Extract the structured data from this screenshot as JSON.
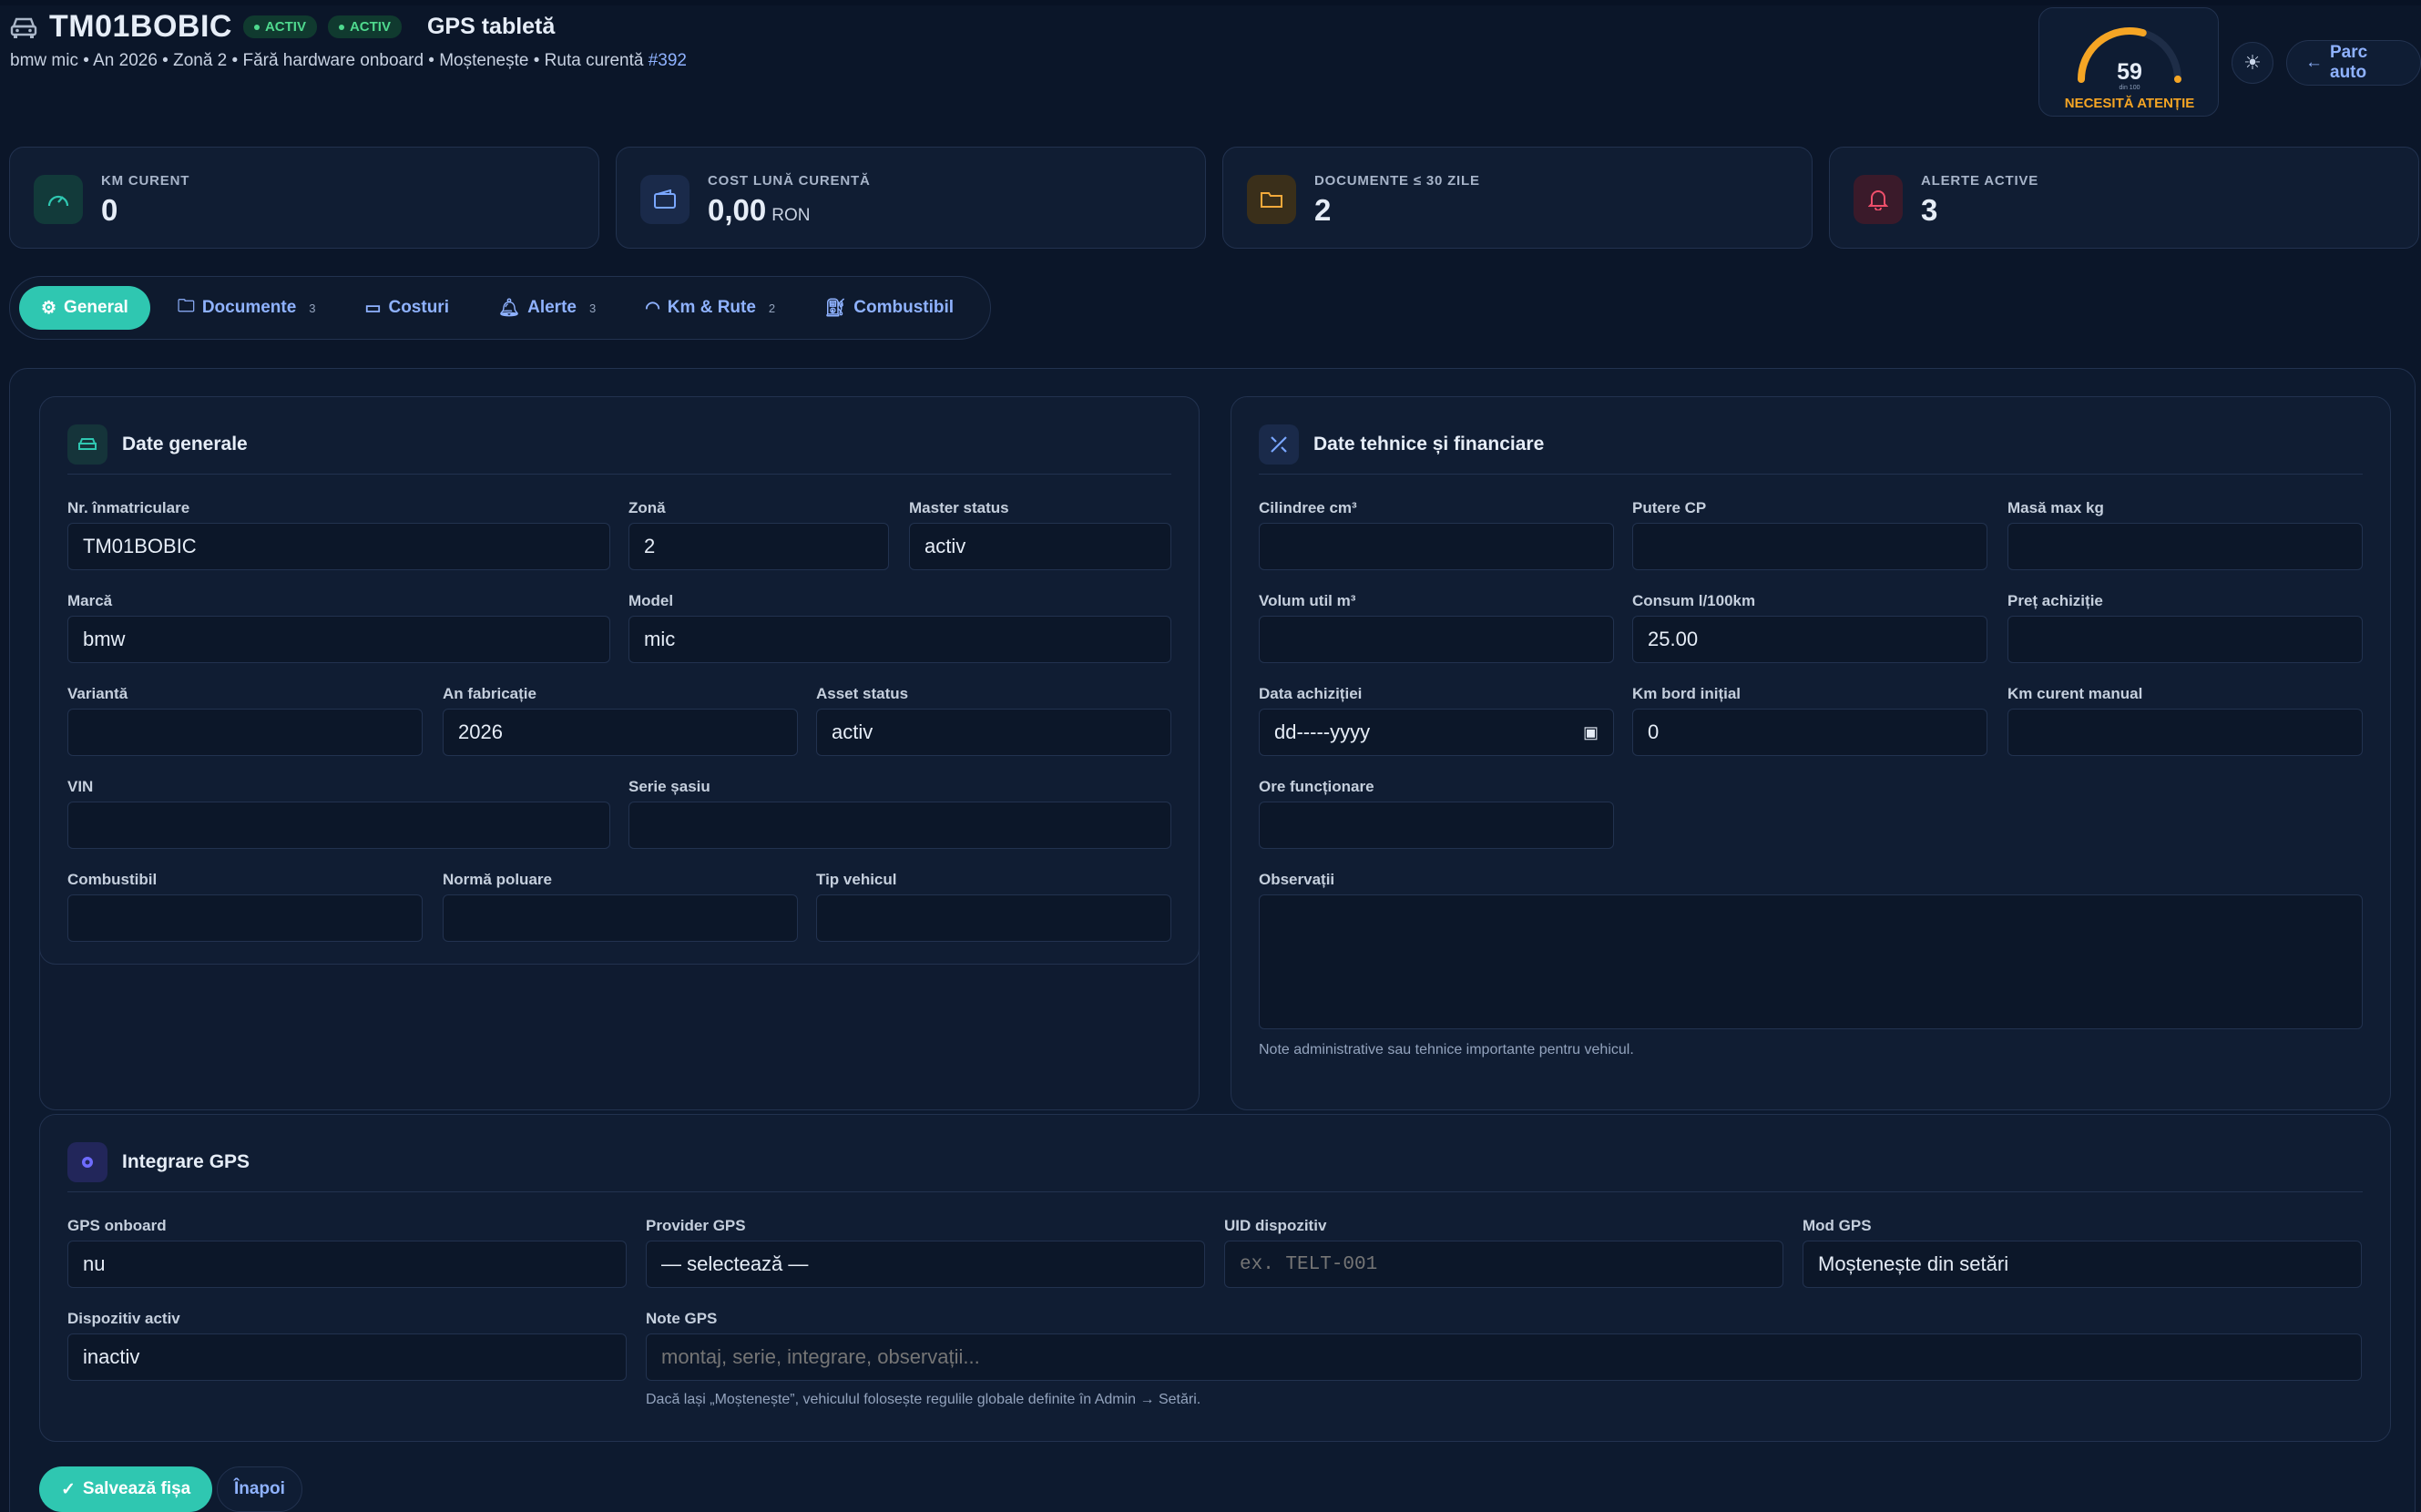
{
  "header": {
    "plate": "TM01BOBIC",
    "badges": [
      "ACTIV",
      "ACTIV"
    ],
    "gps_title": "GPS tabletă",
    "subtitle_text": "bmw mic • An 2026 • Zonă 2 • Fără hardware onboard • Moștenește • Ruta curentă ",
    "route_link": "#392",
    "health_score": "59",
    "health_of": "din 100",
    "health_score_value": 59,
    "health_status": "NECESITĂ ATENȚIE",
    "back_label": "Parc auto"
  },
  "colors": {
    "teal": "#2fc7b1",
    "warning": "#f5a524",
    "alert": "#ef4f6b",
    "folder": "#f2a93b",
    "blue": "#7aa7ff"
  },
  "kpis": [
    {
      "label": "KM CURENT",
      "value": "0",
      "unit": "",
      "icon": "speedometer-icon"
    },
    {
      "label": "COST LUNĂ CURENTĂ",
      "value": "0,00",
      "unit": "RON",
      "icon": "wallet-icon"
    },
    {
      "label": "DOCUMENTE ≤ 30 ZILE",
      "value": "2",
      "unit": "",
      "icon": "folder-icon"
    },
    {
      "label": "ALERTE ACTIVE",
      "value": "3",
      "unit": "",
      "icon": "bell-icon"
    }
  ],
  "tabs": [
    {
      "label": "General",
      "count": "",
      "icon": "gear-icon",
      "active": true
    },
    {
      "label": "Documente",
      "count": "3",
      "icon": "folder-icon"
    },
    {
      "label": "Costuri",
      "count": "",
      "icon": "wallet-icon"
    },
    {
      "label": "Alerte",
      "count": "3",
      "icon": "bell-icon"
    },
    {
      "label": "Km & Rute",
      "count": "2",
      "icon": "speedometer-icon"
    },
    {
      "label": "Combustibil",
      "count": "",
      "icon": "fuel-pump-icon"
    }
  ],
  "general": {
    "title": "Date generale",
    "fields": {
      "nr_label": "Nr. înmatriculare",
      "nr_value": "TM01BOBIC",
      "zona_label": "Zonă",
      "zona_value": "2",
      "master_label": "Master status",
      "master_value": "activ",
      "marca_label": "Marcă",
      "marca_value": "bmw",
      "model_label": "Model",
      "model_value": "mic",
      "varianta_label": "Variantă",
      "varianta_value": "",
      "an_label": "An fabricație",
      "an_value": "2026",
      "asset_label": "Asset status",
      "asset_value": "activ",
      "vin_label": "VIN",
      "vin_value": "",
      "sasiu_label": "Serie șasiu",
      "sasiu_value": "",
      "comb_label": "Combustibil",
      "comb_value": "",
      "norma_label": "Normă poluare",
      "norma_value": "",
      "tip_label": "Tip vehicul",
      "tip_value": ""
    }
  },
  "tech": {
    "title": "Date tehnice și financiare",
    "fields": {
      "cil_label": "Cilindree cm³",
      "cil_value": "",
      "putere_label": "Putere CP",
      "putere_value": "",
      "masa_label": "Masă max kg",
      "masa_value": "",
      "volum_label": "Volum util m³",
      "volum_value": "",
      "consum_label": "Consum l/100km",
      "consum_value": "25.00",
      "pret_label": "Preț achiziție",
      "pret_value": "",
      "data_label": "Data achiziției",
      "data_placeholder": "dd-----yyyy",
      "kmbord_label": "Km bord inițial",
      "kmbord_value": "0",
      "kmcur_label": "Km curent manual",
      "kmcur_value": "",
      "ore_label": "Ore funcționare",
      "ore_value": "",
      "obs_label": "Observații",
      "obs_value": "",
      "obs_hint": "Note administrative sau tehnice importante pentru vehicul."
    }
  },
  "gps": {
    "title": "Integrare GPS",
    "onboard_label": "GPS onboard",
    "onboard_value": "nu",
    "provider_label": "Provider GPS",
    "provider_value": "— selectează —",
    "uid_label": "UID dispozitiv",
    "uid_placeholder": "ex. TELT-001",
    "mod_label": "Mod GPS",
    "mod_value": "Moștenește din setări",
    "disp_label": "Dispozitiv activ",
    "disp_value": "inactiv",
    "note_label": "Note GPS",
    "note_placeholder": "montaj, serie, integrare, observații...",
    "hint": "Dacă lași „Moștenește”, vehiculul folosește regulile globale definite în Admin → Setări."
  },
  "actions": {
    "save": "Salvează fișa",
    "back": "Înapoi"
  }
}
